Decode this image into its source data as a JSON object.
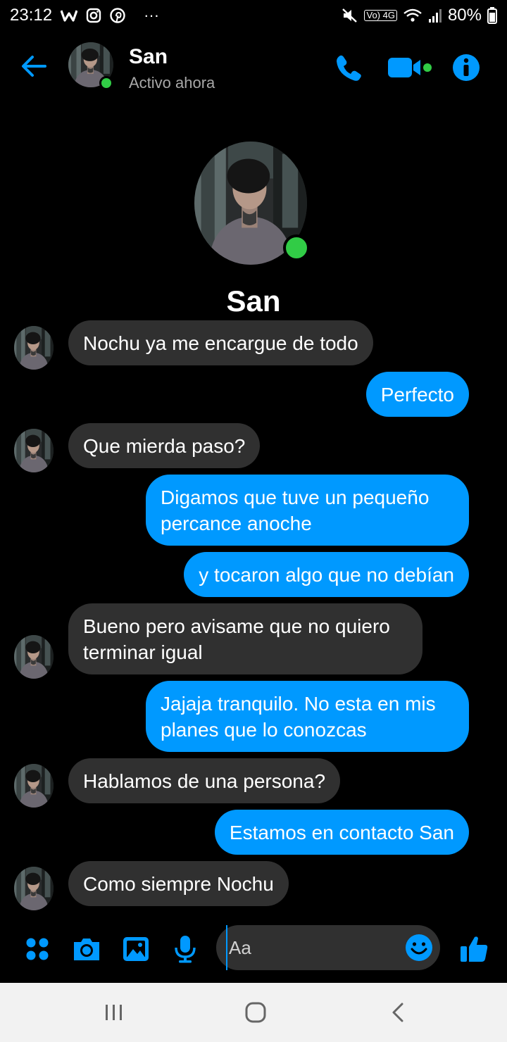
{
  "status_bar": {
    "time": "23:12",
    "notification_icons": [
      "w-app-icon",
      "instagram-icon",
      "pinterest-icon",
      "more-dots-icon"
    ],
    "more_label": "···",
    "network_label": "Vo) 4G",
    "battery": "80%"
  },
  "header": {
    "name": "San",
    "status": "Activo ahora"
  },
  "profile": {
    "name": "San"
  },
  "messages": [
    {
      "from": "them",
      "text": "Nochu ya me encargue de todo"
    },
    {
      "from": "me",
      "text": "Perfecto"
    },
    {
      "from": "them",
      "text": "Que mierda paso?"
    },
    {
      "from": "me",
      "text": "Digamos que tuve un pequeño percance anoche"
    },
    {
      "from": "me",
      "text": "y tocaron algo que no debían"
    },
    {
      "from": "them",
      "text": "Bueno pero avisame que no quiero terminar igual"
    },
    {
      "from": "me",
      "text": "Jajaja tranquilo. No esta en mis planes que lo conozcas"
    },
    {
      "from": "them",
      "text": "Hablamos de una persona?"
    },
    {
      "from": "me",
      "text": "Estamos en contacto San"
    },
    {
      "from": "them",
      "text": "Como siempre Nochu"
    }
  ],
  "composer": {
    "placeholder": "Aa"
  },
  "colors": {
    "accent": "#0099ff",
    "incoming_bubble": "#303030",
    "online": "#31cc46",
    "background": "#000000"
  }
}
